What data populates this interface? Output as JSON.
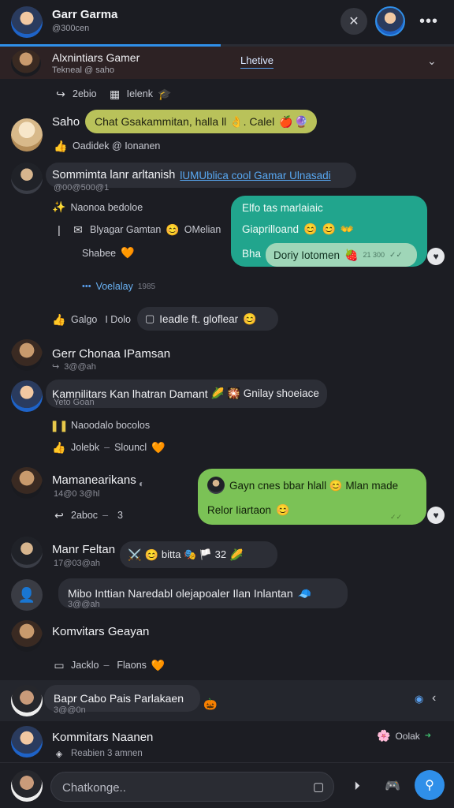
{
  "header": {
    "title": "Garr Garma",
    "subtitle": "@300cen",
    "more_icon": "more-icon",
    "tools_icon": "tools-icon"
  },
  "pinned": {
    "title": "Alxnintiars Gamer",
    "subtitle": "Tekneal @ saho",
    "tab_label": "Lhetive"
  },
  "messages": [
    {
      "meta_left": "2ebio",
      "meta_right": "Ielenk"
    },
    {
      "name": "Saho",
      "bubble": "Chat Gsakammitan, halla ll 👌. Calel",
      "reaction_line": "Oadidek @ Ionanen"
    },
    {
      "name": "Sommimta lanr arltanish",
      "link_text": "lUMUblica cool Gamar Ulnasadi",
      "time": "@00@500@1",
      "line1": "Naonoa bedoloe",
      "line2": "Blyagar Gamtan",
      "line2b": "OMelian",
      "line3": "Shabee",
      "link2": "Voelalay",
      "link2_time": "1985",
      "react_label_1": "Galgo",
      "react_label_2": "I Dolo",
      "react_pill": "Ieadle ft. gloflear",
      "right_bubble": {
        "line1": "Elfo tas marlaiaic",
        "line2": "Giaprilloand",
        "line3": "Bha",
        "pill": "Doriy Iotomen",
        "pill_time": "21 300"
      }
    },
    {
      "name": "Gerr Chonaa IPamsan",
      "time": "3@@ah"
    },
    {
      "name": "Kamnilitars Kan lhatran Damant",
      "bubble": "🌽 🎇 Gnilay shoeiace",
      "time": "Yeto Goan",
      "line1": "Naoodalo bocolos",
      "line2a": "Jolebk",
      "line2b": "Slouncl"
    },
    {
      "name": "Mamanearikans",
      "time": "14@0 3@hl",
      "meta_a": "2aboc",
      "meta_b": "3",
      "right_bubble": {
        "line1": "Gayn cnes bbar hlall 😊 Mlan made",
        "line2": "Relor Iiartaon"
      }
    },
    {
      "name": "Manr Feltan",
      "time": "17@03@ah",
      "bubble": "bitta 🎭 🏳️ 32"
    },
    {
      "text": "Mibo Inttian Naredabl olejapoaler Ilan Inlantan",
      "time": "3@@ah"
    },
    {
      "name": "Komvitars Geayan",
      "meta_a": "Jacklo",
      "meta_b": "Flaons"
    },
    {
      "name": "Bapr Cabo Pais Parlakaen",
      "time": "3@@0n"
    },
    {
      "name": "Kommitars Naanen",
      "sub": "Reabien 3 amnen",
      "right": "Oolak"
    }
  ],
  "composer": {
    "placeholder": "Chatkonge.."
  },
  "colors": {
    "bg": "#1c1d23",
    "accent": "#2f8fe9",
    "teal": "#21a58d",
    "green": "#7bc256",
    "yellow": "#b9c25a"
  }
}
